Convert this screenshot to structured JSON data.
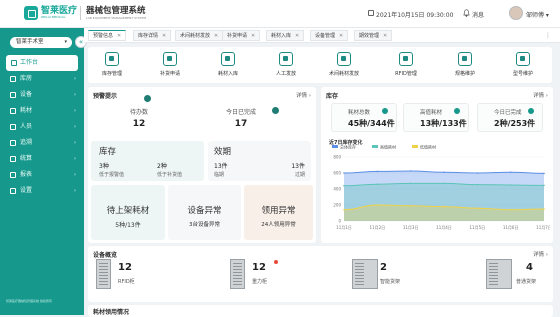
{
  "header": {
    "logo_text": "智莱医疗",
    "logo_sub": "ZHILAI MEDICAL",
    "app_title": "器械包管理系统",
    "app_sub": "LAB EQUIPMENT MANAGEMENT SYSTEM",
    "datetime": "2021年10月15日 09:30:00",
    "messages": "消息",
    "user": "邹师傅"
  },
  "sidebar": {
    "dept": "智莱手术室",
    "collapse": "«",
    "items": [
      {
        "label": "工作台",
        "expand": ""
      },
      {
        "label": "库房",
        "expand": "›"
      },
      {
        "label": "设备",
        "expand": "›"
      },
      {
        "label": "耗材",
        "expand": "›"
      },
      {
        "label": "人员",
        "expand": "›"
      },
      {
        "label": "追溯",
        "expand": "›"
      },
      {
        "label": "统算",
        "expand": "›"
      },
      {
        "label": "报表",
        "expand": "›"
      },
      {
        "label": "设置",
        "expand": "›"
      }
    ],
    "footer": "智莱医疗器械包管理系统 版权所有"
  },
  "tabs": [
    "预警信息",
    "库存详情",
    "术间耗材发放",
    "补货申请",
    "耗材入库",
    "设备管理",
    "期效管理"
  ],
  "quick": [
    "库存管理",
    "补货申请",
    "耗材入库",
    "人工发放",
    "术间耗材发放",
    "RFID管理",
    "规格维护",
    "型号维护"
  ],
  "alerts": {
    "title": "预警提示",
    "more": "详情 ›",
    "todo_label": "待办数",
    "todo_value": "12",
    "done_label": "今日已完成",
    "done_value": "17",
    "stock_title": "库存",
    "stock_a_value": "3种",
    "stock_a_label": "低于报警值",
    "stock_b_value": "2种",
    "stock_b_label": "低于补货值",
    "expiry_title": "效期",
    "expiry_a_value": "13件",
    "expiry_a_label": "临期",
    "expiry_b_value": "13件",
    "expiry_b_label": "过期",
    "shelf_title": "待上架耗材",
    "shelf_value": "5种/13件",
    "device_title": "设备异常",
    "device_value": "3台设备异常",
    "pickup_title": "领用异常",
    "pickup_value": "24人领用异常"
  },
  "inventory": {
    "title": "库存",
    "more": "详情 ›",
    "kpis": [
      {
        "label": "耗材总数",
        "value": "45种/344件"
      },
      {
        "label": "高值耗材",
        "value": "13种/133件"
      },
      {
        "label": "今日已完成",
        "value": "2种/253件"
      }
    ],
    "chart_title": "近7日库存变化",
    "colors": {
      "total": "#5b8fe8",
      "high": "#5cc4b8",
      "low": "#f0d24a"
    }
  },
  "chart_data": {
    "type": "area",
    "title": "近7日库存变化",
    "categories": [
      "11月1日",
      "11月2日",
      "11月3日",
      "11月4日",
      "11月5日",
      "11月6日",
      "11月7日"
    ],
    "series": [
      {
        "name": "总体库存",
        "values": [
          600,
          620,
          625,
          610,
          600,
          610,
          595
        ]
      },
      {
        "name": "高值耗材",
        "values": [
          440,
          460,
          470,
          470,
          455,
          450,
          445
        ]
      },
      {
        "name": "低值耗材",
        "values": [
          140,
          200,
          190,
          180,
          160,
          140,
          150
        ]
      }
    ],
    "ylim": [
      0,
      800
    ],
    "yticks": [
      "800",
      "600",
      "400",
      "200",
      "0"
    ],
    "grid": true,
    "legend": "top"
  },
  "devices": {
    "title": "设备概览",
    "more": "详情 ›",
    "items": [
      {
        "value": "12",
        "label": "RFID柜"
      },
      {
        "value": "12",
        "label": "重力柜"
      },
      {
        "value": "2",
        "label": "智能货架"
      },
      {
        "value": "4",
        "label": "普通货架"
      }
    ]
  },
  "usage": {
    "title": "耗材领用情况"
  }
}
